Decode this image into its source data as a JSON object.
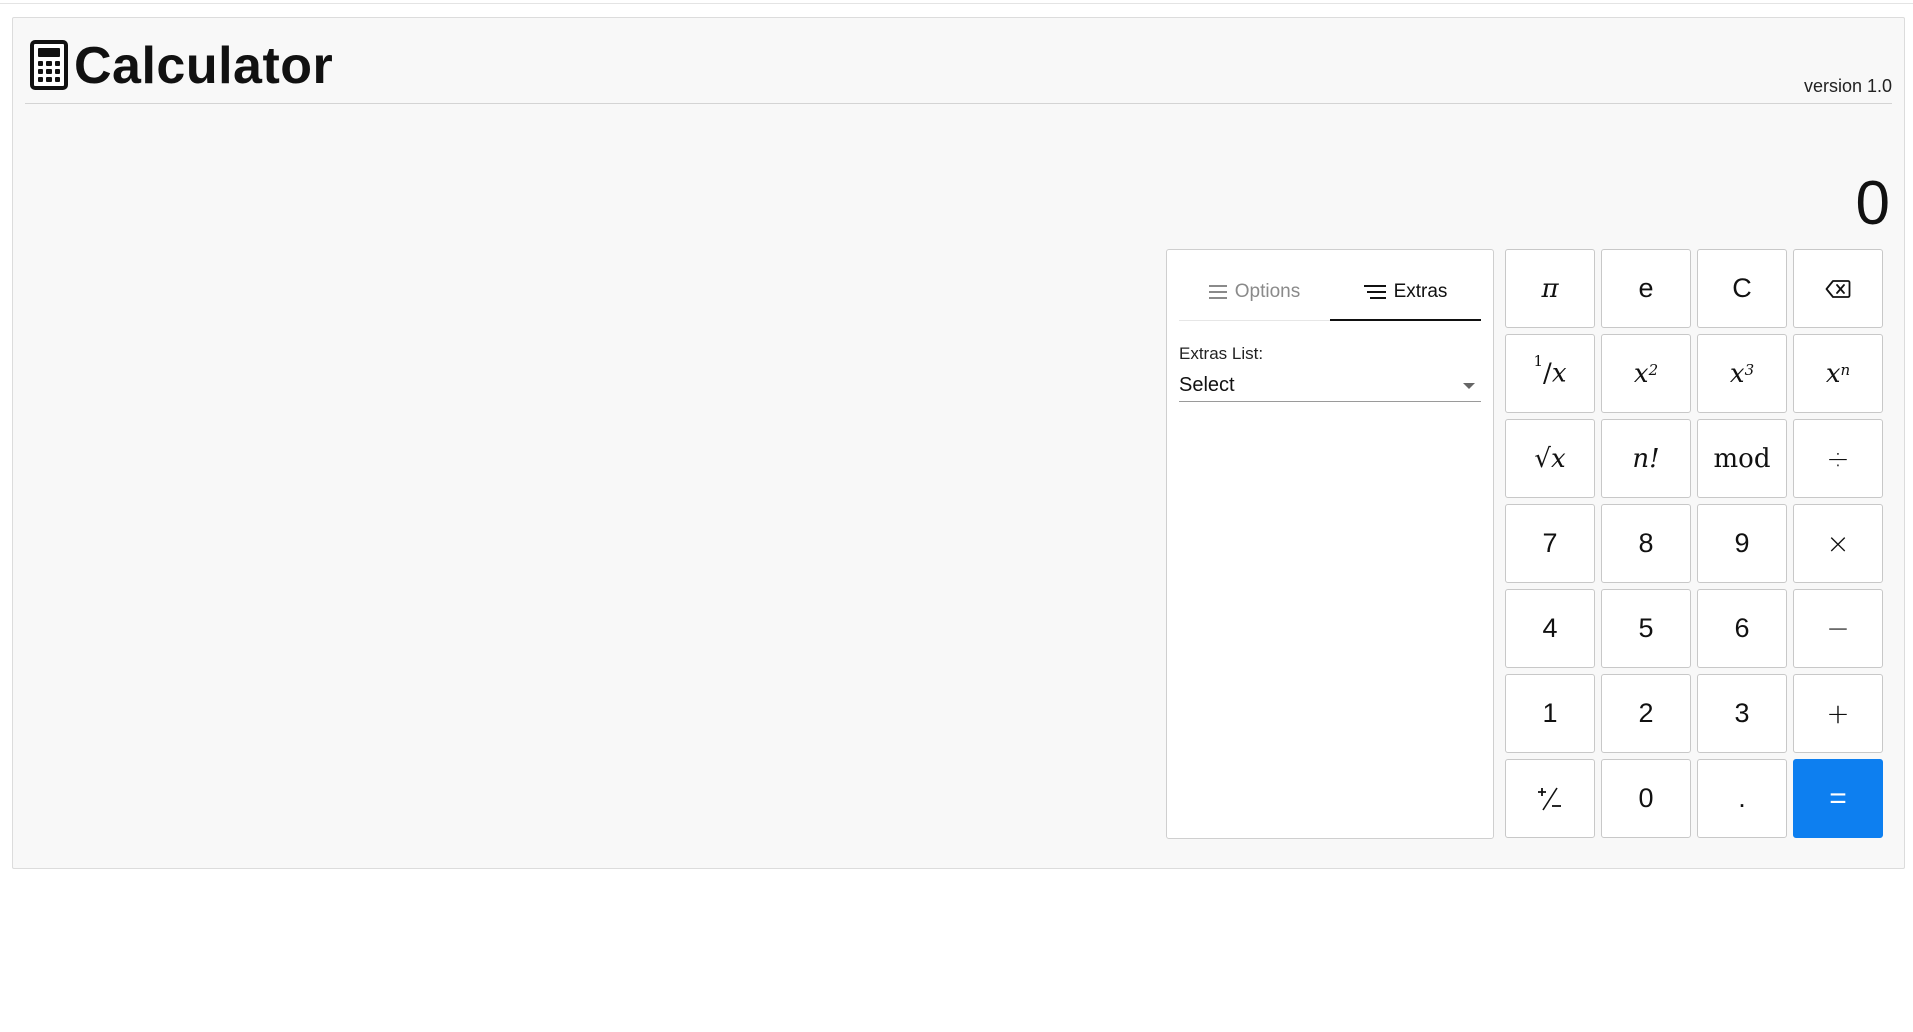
{
  "app": {
    "title": "Calculator",
    "version": "version 1.0"
  },
  "display": {
    "value": "0"
  },
  "panel": {
    "tabs": [
      {
        "label": "Options",
        "active": false,
        "icon": "menu-icon"
      },
      {
        "label": "Extras",
        "active": true,
        "icon": "menu-staggered-icon"
      }
    ],
    "extras_label": "Extras List:",
    "select_value": "Select"
  },
  "keypad": {
    "pi": "π",
    "e": "e",
    "clear": "C",
    "backspace_icon": "backspace-icon",
    "reciprocal": "1/x",
    "square": "x2",
    "cube": "x3",
    "power": "xn",
    "sqrt": "√x",
    "factorial": "n!",
    "mod": "mod",
    "divide": "÷",
    "seven": "7",
    "eight": "8",
    "nine": "9",
    "multiply": "×",
    "four": "4",
    "five": "5",
    "six": "6",
    "minus": "−",
    "one": "1",
    "two": "2",
    "three": "3",
    "plus": "+",
    "negate": "⁺∕₋",
    "zero": "0",
    "decimal": ".",
    "equals": "="
  },
  "colors": {
    "accent": "#0d7ff0",
    "card_bg": "#f8f8f8"
  }
}
